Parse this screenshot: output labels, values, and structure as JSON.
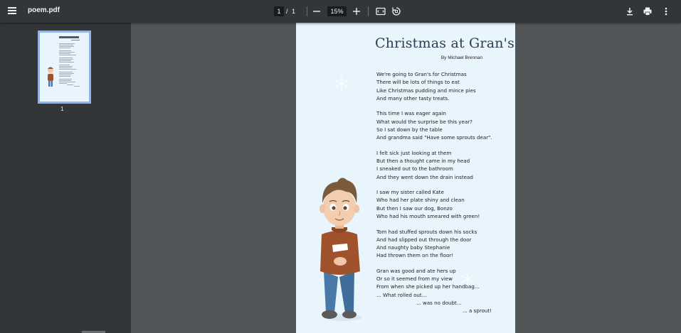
{
  "toolbar": {
    "menu_icon": "hamburger-menu-icon",
    "file_name": "poem.pdf",
    "current_page": "1",
    "page_separator": "/",
    "total_pages": "1",
    "zoom_level": "15%",
    "zoom_out_icon": "minus-icon",
    "zoom_in_icon": "plus-icon",
    "fit_icon": "fit-to-page-icon",
    "rotate_icon": "rotate-icon",
    "download_icon": "download-icon",
    "print_icon": "print-icon",
    "more_icon": "more-vertical-icon"
  },
  "sidebar": {
    "thumbnail_page_number": "1"
  },
  "document": {
    "title": "Christmas at Gran's.",
    "author": "By Michael Brennan",
    "stanzas": [
      [
        "We're going to Gran's for Christmas",
        "There will be lots of things to eat",
        "Like Christmas pudding and mince pies",
        "And many other tasty treats."
      ],
      [
        "This time I was eager again",
        "What would the surprise be this year?",
        "So I sat down by the table",
        "And grandma said \"Have some sprouts dear\"."
      ],
      [
        "I felt sick just looking at them",
        "But then a thought came in my head",
        "I sneaked out to the bathroom",
        "And they went down the drain instead"
      ],
      [
        "I saw my sister called Kate",
        "Who had her plate shiny and clean",
        "But then I saw our dog, Bonzo",
        "Who had his mouth smeared with green!"
      ],
      [
        "Tom had stuffed sprouts down his socks",
        "And had slipped out through the door",
        "And naughty baby Stephanie",
        "Had thrown them on the floor!"
      ],
      [
        "Gran was good and ate hers up",
        "Or so it seemed from my view",
        "From when she picked up her handbag...",
        "... What rolled out...",
        "... was no doubt...",
        "... a sprout!"
      ]
    ],
    "illustration": "boy-illustration",
    "decorations": [
      "snowflake-icon",
      "snowflake-icon"
    ]
  },
  "colors": {
    "toolbar_bg": "#323639",
    "viewer_bg": "#525659",
    "page_bg": "#e8f5fc",
    "thumbnail_border": "#8ab4f8",
    "title_color": "#2a3d52"
  }
}
